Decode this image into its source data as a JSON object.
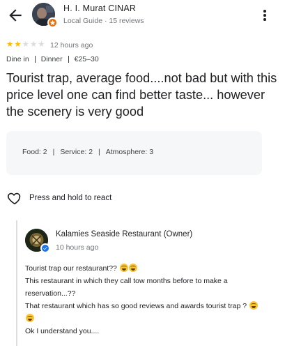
{
  "reviewer": {
    "name": "H. I. Murat CINAR",
    "meta": "Local Guide · 15 reviews"
  },
  "review": {
    "rating": 2,
    "max_rating": 5,
    "time": "12 hours ago",
    "tags": [
      "Dine in",
      "Dinner",
      "€25–30"
    ],
    "text": "Tourist trap, average food....not bad but with this price level one can find better taste... however the scenery is very good",
    "ratings": [
      {
        "label": "Food: 2"
      },
      {
        "label": "Service: 2"
      },
      {
        "label": "Atmosphere: 3"
      }
    ]
  },
  "react": {
    "label": "Press and hold to react"
  },
  "owner_response": {
    "name": "Kalamies Seaside Restaurant (Owner)",
    "time": "10 hours ago",
    "lines": [
      "Tourist trap our restaurant??",
      "This restaurant in which they call tow months before to make a reservation...??",
      "That restaurant which has so good reviews and awards tourist trap ?",
      "Ok I understand you...."
    ]
  },
  "colors": {
    "star_on": "#fbbc04",
    "star_off": "#dadce0",
    "local_guide_badge": "#e8710a",
    "verified_badge": "#1a73e8",
    "card_bg": "#f6f7f8"
  },
  "icons": {
    "back": "arrow-back-icon",
    "more": "more-vert-icon",
    "react": "heart-outline-icon",
    "guide": "local-guide-star-icon",
    "verified": "verified-check-icon"
  }
}
